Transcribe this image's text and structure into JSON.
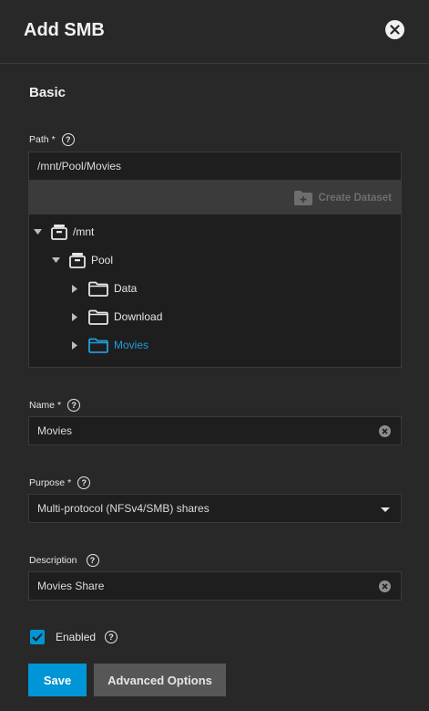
{
  "header": {
    "title": "Add SMB"
  },
  "section": {
    "title": "Basic"
  },
  "path": {
    "label": "Path",
    "required": "*",
    "help": "?",
    "value": "/mnt/Pool/Movies",
    "create_dataset_label": "Create Dataset"
  },
  "tree": {
    "mnt": "/mnt",
    "pool": "Pool",
    "data": "Data",
    "download": "Download",
    "movies": "Movies"
  },
  "name": {
    "label": "Name",
    "required": "*",
    "help": "?",
    "value": "Movies"
  },
  "purpose": {
    "label": "Purpose",
    "required": "*",
    "help": "?",
    "value": "Multi-protocol (NFSv4/SMB) shares"
  },
  "description": {
    "label": "Description",
    "help": "?",
    "value": "Movies Share"
  },
  "enabled": {
    "label": "Enabled",
    "help": "?",
    "checked": true
  },
  "buttons": {
    "save": "Save",
    "advanced": "Advanced Options"
  },
  "colors": {
    "background": "#282828",
    "accent": "#0095d5",
    "selected": "#1f9fdc",
    "field": "#1e1e1e"
  }
}
